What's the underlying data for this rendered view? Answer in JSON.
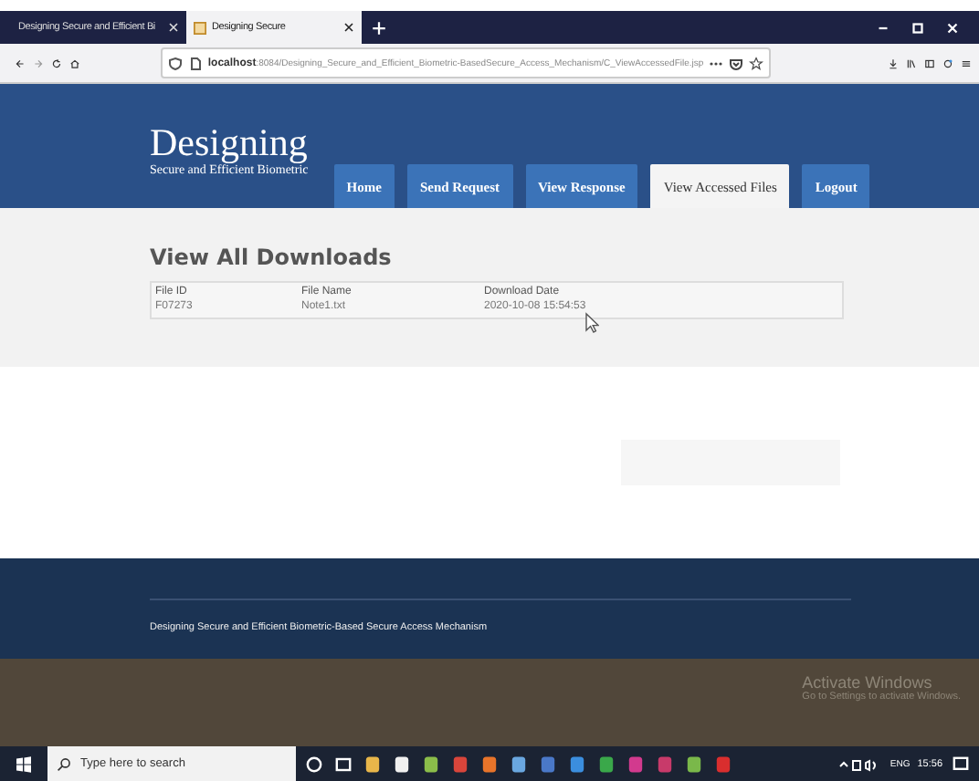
{
  "browser": {
    "tabs": [
      {
        "title": "Designing Secure and Efficient Bi",
        "selected": false
      },
      {
        "title": "Designing Secure",
        "selected": true
      }
    ],
    "address": {
      "host": "localhost",
      "path": ":8084/Designing_Secure_and_Efficient_Biometric-BasedSecure_Access_Mechanism/C_ViewAccessedFile.jsp"
    }
  },
  "header": {
    "title": "Designing",
    "subtitle": "Secure and Efficient Biometric",
    "nav": [
      {
        "label": "Home",
        "selected": false
      },
      {
        "label": "Send Request",
        "selected": false
      },
      {
        "label": "View Response",
        "selected": false
      },
      {
        "label": "View Accessed Files",
        "selected": true
      },
      {
        "label": "Logout",
        "selected": false
      }
    ]
  },
  "content": {
    "heading": "View All Downloads",
    "table": {
      "columns": [
        "File ID",
        "File Name",
        "Download Date"
      ],
      "rows": [
        [
          "F07273",
          "Note1.txt",
          "2020-10-08 15:54:53"
        ]
      ]
    }
  },
  "footer": {
    "text": "Designing Secure and Efficient Biometric-Based Secure Access Mechanism"
  },
  "desktop": {
    "activation_title": "Activate Windows",
    "activation_text": "Go to Settings to activate Windows."
  },
  "taskbar": {
    "search_placeholder": "Type here to search",
    "language": "ENG",
    "time": "15:56"
  }
}
